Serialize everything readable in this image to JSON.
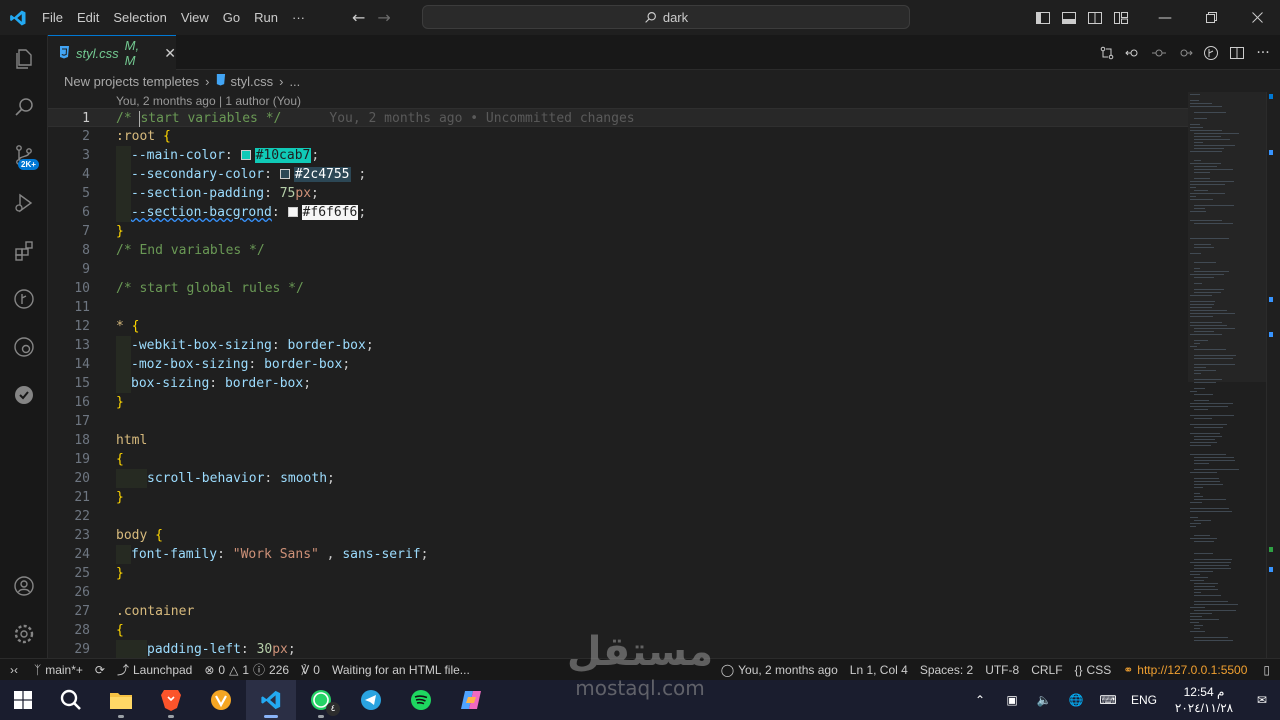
{
  "titlebar": {
    "menu": [
      "File",
      "Edit",
      "Selection",
      "View",
      "Go",
      "Run",
      "···"
    ],
    "search": "dark",
    "window_controls": [
      "minimize-icon",
      "restore-icon",
      "close-icon"
    ]
  },
  "activitybar": {
    "items": [
      "explorer-icon",
      "search-icon",
      "source-control-icon",
      "run-debug-icon",
      "extensions-icon",
      "git-graph-icon",
      "remote-explorer-icon",
      "testing-icon"
    ],
    "scm_badge": "2K+",
    "bottom": [
      "account-icon",
      "settings-icon"
    ]
  },
  "tab": {
    "name": "styl.css",
    "status": "M, M"
  },
  "breadcrumb": {
    "folder": "New projects templetes",
    "file": "styl.css",
    "more": "..."
  },
  "codelens": "You, 2 months ago | 1 author (You)",
  "blame": "You, 2 months ago • Uncommitted changes",
  "code": {
    "l1": "start variables */",
    "root": ":root",
    "v1_name": "--main-color",
    "v1_val": "#10cab7",
    "v2_name": "--secondary-color",
    "v2_val": "#2c4755",
    "v3_name": "--section-padding",
    "v3_num": "75",
    "v3_unit": "px",
    "v4_name": "--section-bacgrond",
    "v4_val": "#f6f6f6",
    "l8": "/* End variables */",
    "l10": "/* start global rules */",
    "star": "*",
    "p13": "-webkit-box-sizing",
    "p14": "-moz-box-sizing",
    "p15": "box-sizing",
    "bb": "border-box",
    "html": "html",
    "p20": "scroll-behavior",
    "v20": "smooth",
    "body": "body",
    "p24": "font-family",
    "v24": "\"Work Sans\"",
    "v24b": "sans-serif",
    "container": ".container",
    "p29": "padding-left",
    "v29": "30",
    "v29u": "px"
  },
  "colors": {
    "main": "#10cab7",
    "secondary": "#2c4755",
    "bg": "#f6f6f6",
    "accent": "#0078d4"
  },
  "statusbar": {
    "branch": "main*+",
    "launchpad": "Launchpad",
    "errors": "0",
    "warnings": "1",
    "info": "226",
    "ports": "0",
    "waiting": "Waiting for an HTML file...",
    "blame": "You, 2 months ago",
    "position": "Ln 1, Col 4",
    "spaces": "Spaces: 2",
    "encoding": "UTF-8",
    "eol": "CRLF",
    "language": "CSS",
    "live": "http://127.0.0.1:5500"
  },
  "taskbar": {
    "apps": [
      "windows-start-icon",
      "search-icon",
      "file-explorer-icon",
      "brave-icon",
      "vpn-icon",
      "vscode-icon",
      "whatsapp-icon",
      "telegram-icon",
      "spotify-icon",
      "copilot-icon"
    ],
    "whatsapp_badge": "٤",
    "lang": "ENG",
    "time": "12:54 م",
    "date": "٢٠٢٤/١١/٢٨"
  },
  "watermark": {
    "text_ar": "مستقل",
    "text_en": "mostaql.com"
  }
}
